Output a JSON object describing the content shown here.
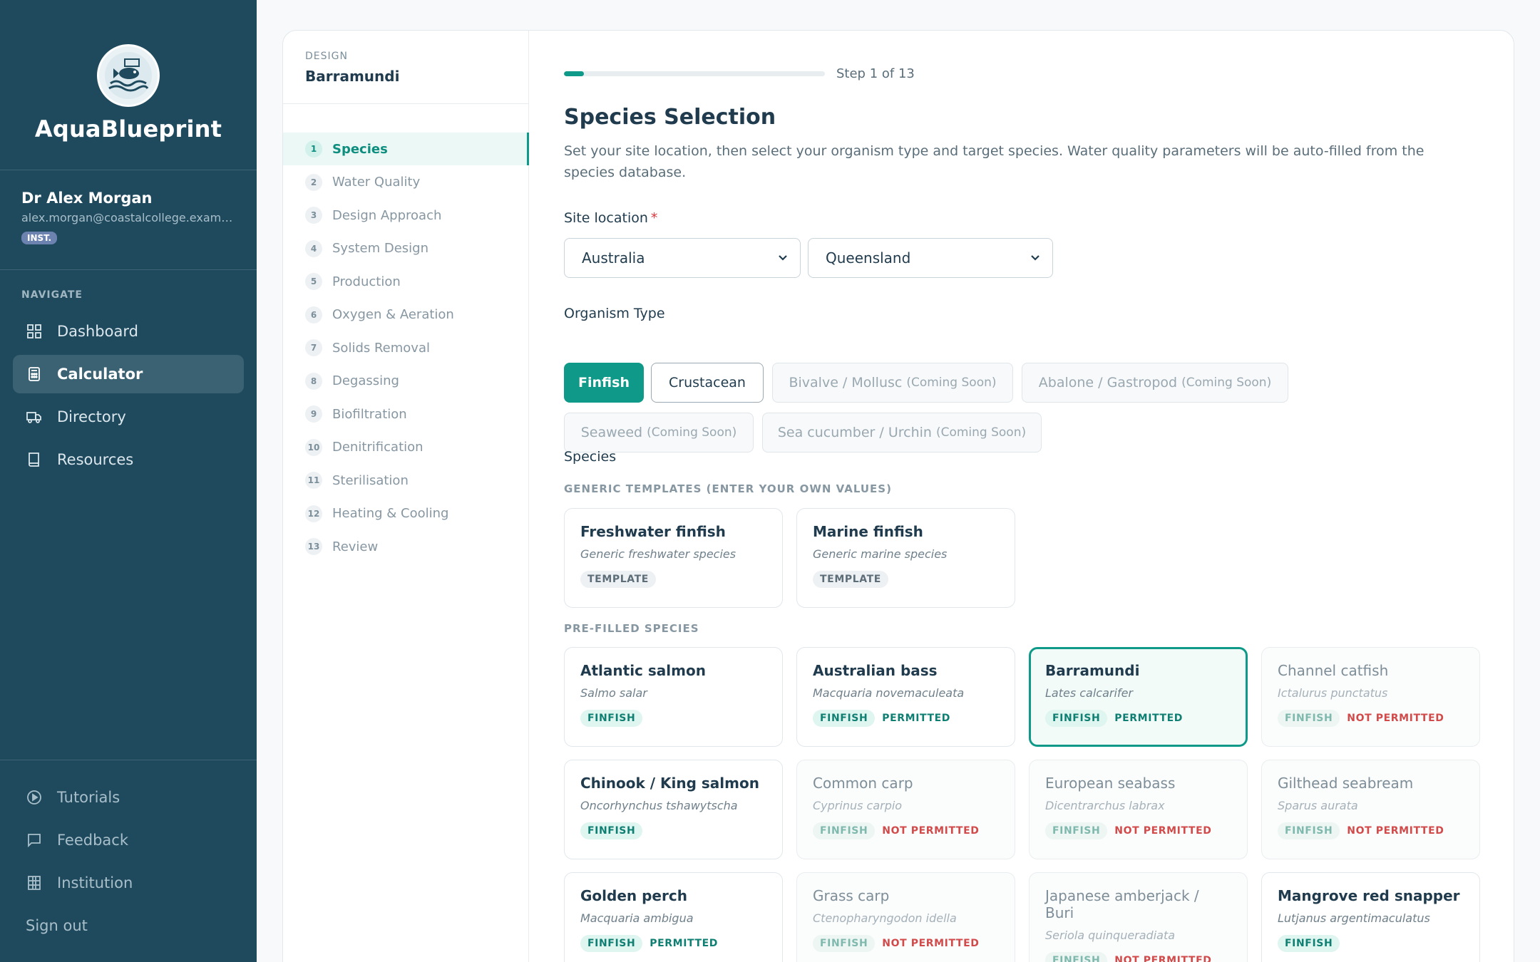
{
  "app": {
    "brand_name": "AquaBlueprint",
    "user_name": "Dr Alex Morgan",
    "user_email": "alex.morgan@coastalcollege.exam…",
    "user_badge": "INST."
  },
  "nav": {
    "heading": "NAVIGATE",
    "items": [
      {
        "label": "Dashboard",
        "icon": "grid-icon"
      },
      {
        "label": "Calculator",
        "icon": "calculator-icon"
      },
      {
        "label": "Directory",
        "icon": "truck-icon"
      },
      {
        "label": "Resources",
        "icon": "book-icon"
      }
    ],
    "bottom": [
      {
        "label": "Tutorials",
        "icon": "play-icon"
      },
      {
        "label": "Feedback",
        "icon": "chat-icon"
      },
      {
        "label": "Institution",
        "icon": "building-icon"
      }
    ],
    "sign_out": "Sign out"
  },
  "design": {
    "label": "DESIGN",
    "name": "Barramundi"
  },
  "steps": [
    {
      "num": "1",
      "label": "Species"
    },
    {
      "num": "2",
      "label": "Water Quality"
    },
    {
      "num": "3",
      "label": "Design Approach"
    },
    {
      "num": "4",
      "label": "System Design"
    },
    {
      "num": "5",
      "label": "Production"
    },
    {
      "num": "6",
      "label": "Oxygen & Aeration"
    },
    {
      "num": "7",
      "label": "Solids Removal"
    },
    {
      "num": "8",
      "label": "Degassing"
    },
    {
      "num": "9",
      "label": "Biofiltration"
    },
    {
      "num": "10",
      "label": "Denitrification"
    },
    {
      "num": "11",
      "label": "Sterilisation"
    },
    {
      "num": "12",
      "label": "Heating & Cooling"
    },
    {
      "num": "13",
      "label": "Review"
    }
  ],
  "progress": {
    "text": "Step 1 of 13",
    "fraction": 0.077
  },
  "page": {
    "title": "Species Selection",
    "description": "Set your site location, then select your organism type and target species. Water quality parameters will be auto-filled from the species database."
  },
  "site": {
    "label": "Site location",
    "required_mark": "*",
    "country": "Australia",
    "region": "Queensland"
  },
  "organism": {
    "label": "Organism Type",
    "options": [
      {
        "label": "Finfish",
        "soon": ""
      },
      {
        "label": "Crustacean",
        "soon": ""
      },
      {
        "label": "Bivalve / Mollusc",
        "soon": "(Coming Soon)"
      },
      {
        "label": "Abalone / Gastropod",
        "soon": "(Coming Soon)"
      },
      {
        "label": "Seaweed",
        "soon": "(Coming Soon)"
      },
      {
        "label": "Sea cucumber / Urchin",
        "soon": "(Coming Soon)"
      }
    ]
  },
  "species": {
    "label": "Species",
    "generic_label": "GENERIC TEMPLATES (ENTER YOUR OWN VALUES)",
    "prefilled_label": "PRE-FILLED SPECIES",
    "templates": [
      {
        "name": "Freshwater finfish",
        "sci": "Generic freshwater species",
        "tag": "TEMPLATE"
      },
      {
        "name": "Marine finfish",
        "sci": "Generic marine species",
        "tag": "TEMPLATE"
      }
    ],
    "prefilled": [
      {
        "name": "Atlantic salmon",
        "sci": "Salmo salar",
        "type": "FINFISH",
        "status": ""
      },
      {
        "name": "Australian bass",
        "sci": "Macquaria novemaculeata",
        "type": "FINFISH",
        "status": "PERMITTED"
      },
      {
        "name": "Barramundi",
        "sci": "Lates calcarifer",
        "type": "FINFISH",
        "status": "PERMITTED"
      },
      {
        "name": "Channel catfish",
        "sci": "Ictalurus punctatus",
        "type": "FINFISH",
        "status": "NOT PERMITTED"
      },
      {
        "name": "Chinook / King salmon",
        "sci": "Oncorhynchus tshawytscha",
        "type": "FINFISH",
        "status": ""
      },
      {
        "name": "Common carp",
        "sci": "Cyprinus carpio",
        "type": "FINFISH",
        "status": "NOT PERMITTED"
      },
      {
        "name": "European seabass",
        "sci": "Dicentrarchus labrax",
        "type": "FINFISH",
        "status": "NOT PERMITTED"
      },
      {
        "name": "Gilthead seabream",
        "sci": "Sparus aurata",
        "type": "FINFISH",
        "status": "NOT PERMITTED"
      },
      {
        "name": "Golden perch",
        "sci": "Macquaria ambigua",
        "type": "FINFISH",
        "status": "PERMITTED"
      },
      {
        "name": "Grass carp",
        "sci": "Ctenopharyngodon idella",
        "type": "FINFISH",
        "status": "NOT PERMITTED"
      },
      {
        "name": "Japanese amberjack / Buri",
        "sci": "Seriola quinqueradiata",
        "type": "FINFISH",
        "status": "NOT PERMITTED"
      },
      {
        "name": "Mangrove red snapper",
        "sci": "Lutjanus argentimaculatus",
        "type": "FINFISH",
        "status": ""
      }
    ]
  },
  "colors": {
    "sidebar": "#1f4a5e",
    "accent": "#0e9988",
    "danger": "#d24a4a"
  }
}
